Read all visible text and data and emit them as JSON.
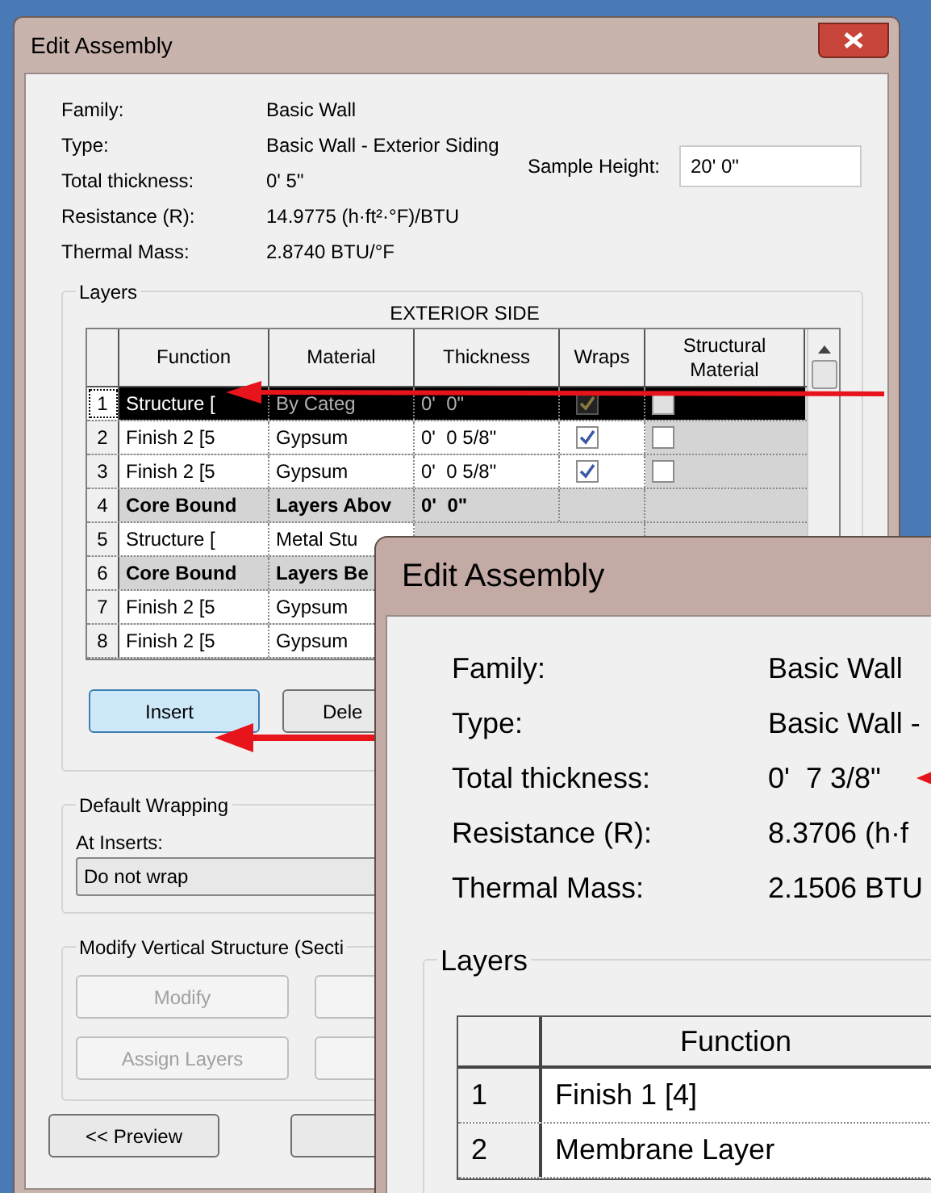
{
  "back_dialog": {
    "title": "Edit Assembly",
    "info": [
      {
        "label": "Family:",
        "value": "Basic Wall"
      },
      {
        "label": "Type:",
        "value": "Basic Wall - Exterior Siding"
      },
      {
        "label": "Total thickness:",
        "value": "0'  5\""
      },
      {
        "label": "Resistance (R):",
        "value": "14.9775 (h·ft²·°F)/BTU"
      },
      {
        "label": "Thermal Mass:",
        "value": "2.8740 BTU/°F"
      }
    ],
    "sample_height": {
      "label": "Sample Height:",
      "value": "20'  0\""
    },
    "layers": {
      "title": "Layers",
      "side_label": "EXTERIOR SIDE",
      "columns": [
        "Function",
        "Material",
        "Thickness",
        "Wraps",
        "Structural Material"
      ],
      "rows": [
        {
          "number": "1",
          "kind": "layer",
          "selected": true,
          "function": "Structure [",
          "material": "By Categ",
          "thickness": "0'  0\"",
          "wraps": true,
          "structural": false
        },
        {
          "number": "2",
          "kind": "layer",
          "selected": false,
          "function": "Finish 2 [5",
          "material": "Gypsum",
          "thickness": "0'  0 5/8\"",
          "wraps": true,
          "structural": false
        },
        {
          "number": "3",
          "kind": "layer",
          "selected": false,
          "function": "Finish 2 [5",
          "material": "Gypsum",
          "thickness": "0'  0 5/8\"",
          "wraps": true,
          "structural": false
        },
        {
          "number": "4",
          "kind": "core",
          "selected": false,
          "function": "Core Bound",
          "material": "Layers Abov",
          "thickness": "0'  0\""
        },
        {
          "number": "5",
          "kind": "hidden",
          "selected": false,
          "function": "Structure [",
          "material": "Metal Stu"
        },
        {
          "number": "6",
          "kind": "hidden_core",
          "selected": false,
          "function": "Core Bound",
          "material": "Layers Be"
        },
        {
          "number": "7",
          "kind": "hidden",
          "selected": false,
          "function": "Finish 2 [5",
          "material": "Gypsum"
        },
        {
          "number": "8",
          "kind": "hidden",
          "selected": false,
          "function": "Finish 2 [5",
          "material": "Gypsum"
        }
      ],
      "buttons": [
        {
          "label": "Insert",
          "highlighted": true
        },
        {
          "label": "Dele",
          "highlighted": false
        }
      ]
    },
    "default_wrapping": {
      "title": "Default Wrapping",
      "label": "At Inserts:",
      "value": "Do not wrap"
    },
    "vertical_structure": {
      "title": "Modify Vertical Structure (Secti",
      "buttons": [
        {
          "label": "Modify",
          "disabled": true
        },
        {
          "label": "Assign Layers",
          "disabled": true
        }
      ]
    },
    "preview_button": "<< Preview"
  },
  "front_dialog": {
    "title": "Edit Assembly",
    "info": [
      {
        "label": "Family:",
        "value": "Basic Wall"
      },
      {
        "label": "Type:",
        "value": "Basic Wall -"
      },
      {
        "label": "Total thickness:",
        "value": "0'  7 3/8\""
      },
      {
        "label": "Resistance (R):",
        "value": "8.3706 (h·f"
      },
      {
        "label": "Thermal Mass:",
        "value": "2.1506 BTU"
      }
    ],
    "layers": {
      "title": "Layers",
      "columns": [
        "Function"
      ],
      "rows": [
        {
          "number": "1",
          "function": "Finish 1 [4]"
        },
        {
          "number": "2",
          "function": "Membrane Layer"
        }
      ]
    }
  }
}
